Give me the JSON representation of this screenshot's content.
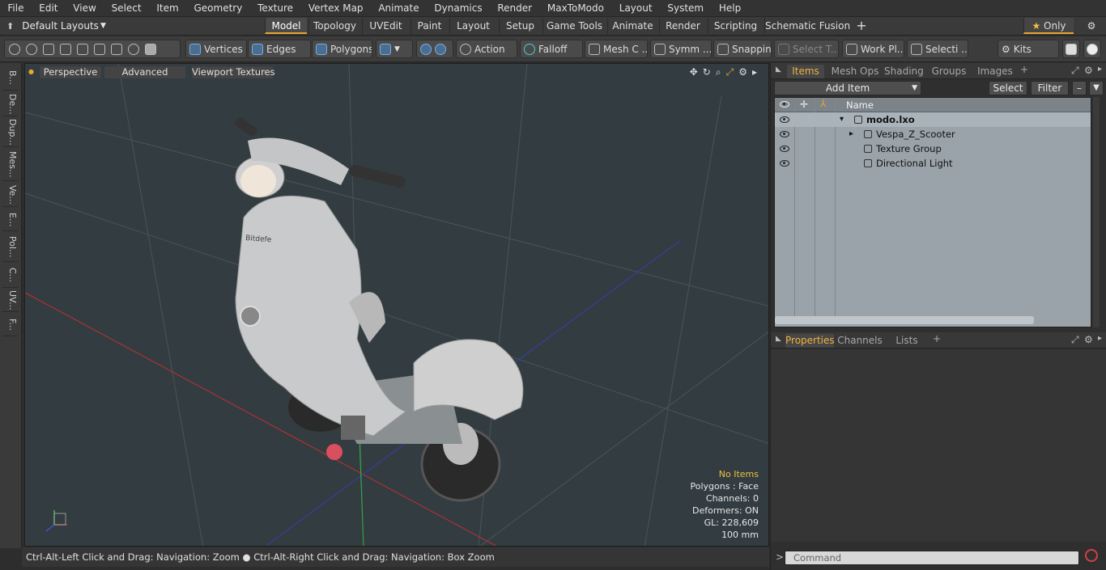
{
  "menu": [
    "File",
    "Edit",
    "View",
    "Select",
    "Item",
    "Geometry",
    "Texture",
    "Vertex Map",
    "Animate",
    "Dynamics",
    "Render",
    "MaxToModo",
    "Layout",
    "System",
    "Help"
  ],
  "layouts": {
    "label": "Default Layouts"
  },
  "tabs": [
    "Model",
    "Topology",
    "UVEdit",
    "Paint",
    "Layout",
    "Setup",
    "Game Tools",
    "Animate",
    "Render",
    "Scripting",
    "Schematic Fusion"
  ],
  "active_tab": "Model",
  "only_label": "Only",
  "toolbar": {
    "vertices": "Vertices",
    "edges": "Edges",
    "polygons": "Polygons",
    "action": "Action",
    "falloff": "Falloff",
    "meshc": "Mesh C ...",
    "symm": "Symm ...",
    "snapping": "Snapping",
    "selectt": "Select T...",
    "workpl": "Work Pl...",
    "selecti": "Selecti ...",
    "kits": "Kits"
  },
  "left_tabs": [
    "B...",
    "De...",
    "Dup...",
    "Mes...",
    "Ve...",
    "E...",
    "Pol...",
    "C...",
    "UV...",
    "F..."
  ],
  "viewport": {
    "perspective": "Perspective",
    "advanced": "Advanced",
    "textures": "Viewport Textures",
    "scooter_label": "Bitdefe"
  },
  "info": {
    "items": "No Items",
    "polygons": "Polygons : Face",
    "channels": "Channels: 0",
    "deformers": "Deformers: ON",
    "gl": "GL: 228,609",
    "scale": "100 mm"
  },
  "status": "Ctrl-Alt-Left Click and Drag: Navigation: Zoom ● Ctrl-Alt-Right Click and Drag: Navigation: Box Zoom",
  "panel_tabs": [
    "Items",
    "Mesh Ops",
    "Shading",
    "Groups",
    "Images"
  ],
  "add_item": "Add Item",
  "select_btn": "Select",
  "filter_btn": "Filter",
  "list_header": "Name",
  "items": [
    {
      "label": "modo.lxo",
      "bold": true
    },
    {
      "label": "Vespa_Z_Scooter"
    },
    {
      "label": "Texture Group"
    },
    {
      "label": "Directional Light"
    }
  ],
  "props_tabs": [
    "Properties",
    "Channels",
    "Lists"
  ],
  "command_placeholder": "Command"
}
